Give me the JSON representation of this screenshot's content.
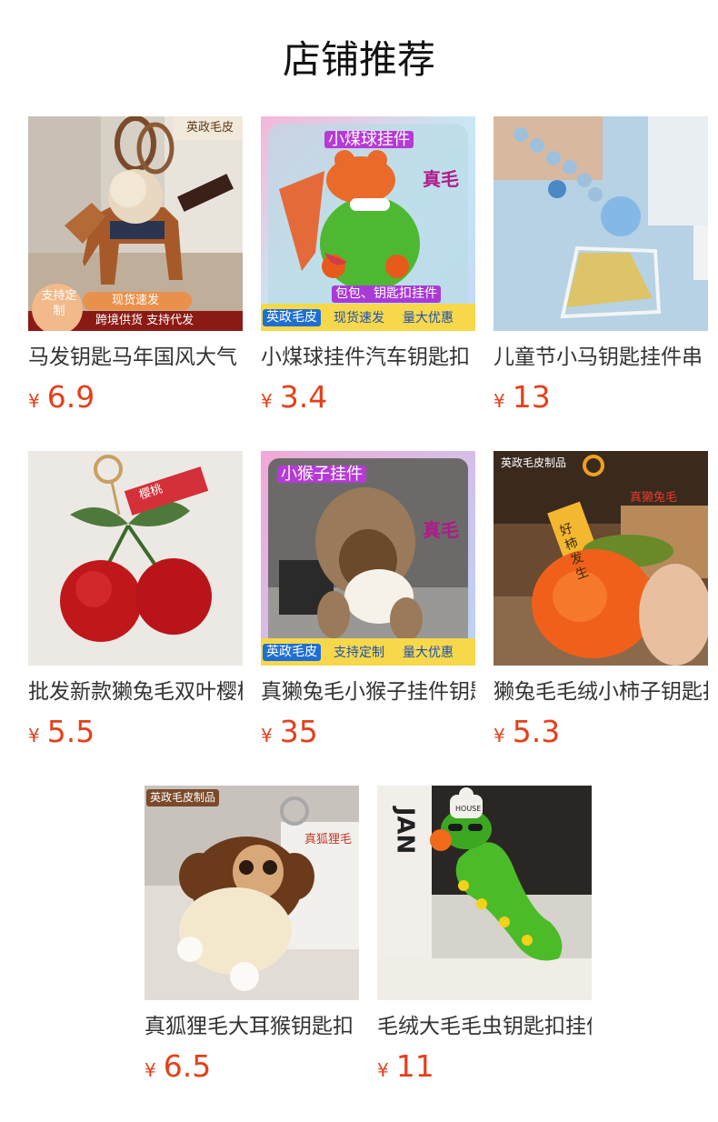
{
  "section": {
    "title": "店铺推荐"
  },
  "currency": "¥",
  "products": [
    {
      "name": "马发钥匙马年国风大气",
      "price": "6.9",
      "tags": {
        "brand": "英政毛皮",
        "custom": "支持定制",
        "fast": "现货速发",
        "bottom": "跨境供货 支持代发"
      }
    },
    {
      "name": "小煤球挂件汽车钥匙扣",
      "price": "3.4",
      "tags": {
        "heading": "小煤球挂件",
        "real": "真毛",
        "sub": "包包、钥匙扣挂件",
        "brand": "英政毛皮",
        "fast": "现货速发",
        "deal": "量大优惠"
      }
    },
    {
      "name": "儿童节小马钥匙挂件串",
      "price": "13",
      "tags": {}
    },
    {
      "name": "批发新款獭兔毛双叶樱桃",
      "price": "5.5",
      "tags": {
        "ribbon": "樱桃"
      }
    },
    {
      "name": "真獭兔毛小猴子挂件钥匙",
      "price": "35",
      "tags": {
        "heading": "小猴子挂件",
        "real": "真毛",
        "brand": "英政毛皮",
        "custom": "支持定制",
        "deal": "量大优惠"
      }
    },
    {
      "name": "獭兔毛毛绒小柿子钥匙扣",
      "price": "5.3",
      "tags": {
        "brand": "英政毛皮制品",
        "real": "真獭兔毛",
        "tag": "好柿发生"
      }
    },
    {
      "name": "真狐狸毛大耳猴钥匙扣",
      "price": "6.5",
      "tags": {
        "brand": "英政毛皮制品",
        "real": "真狐狸毛"
      }
    },
    {
      "name": "毛绒大毛毛虫钥匙扣挂件",
      "price": "11",
      "tags": {
        "poster": "JAN",
        "hat": "HOUSE"
      }
    }
  ]
}
